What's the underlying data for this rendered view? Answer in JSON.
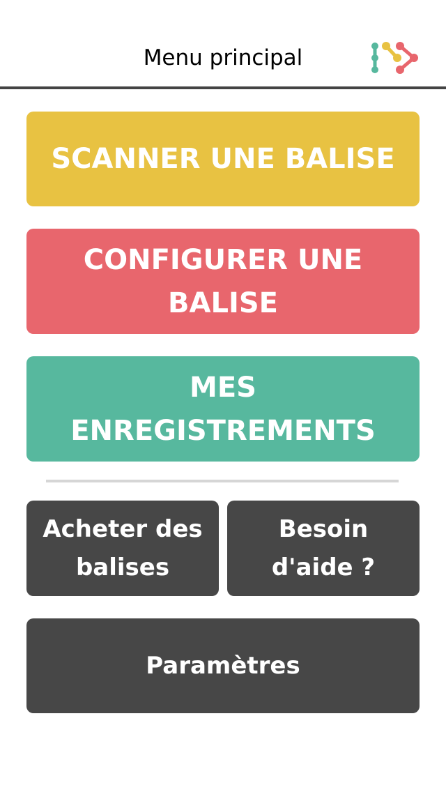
{
  "header": {
    "title": "Menu principal",
    "logo_icon": "network-nodes-logo"
  },
  "buttons": {
    "scan": {
      "label": "SCANNER UNE BALISE",
      "color": "#E8C242"
    },
    "configure": {
      "label": "CONFIGURER UNE BALISE",
      "color": "#E8666D"
    },
    "records": {
      "label": "MES ENREGISTREMENTS",
      "color": "#57B89E"
    },
    "buy": {
      "label": "Acheter des balises",
      "color": "#474747"
    },
    "help": {
      "label": "Besoin d'aide ?",
      "color": "#474747"
    },
    "settings": {
      "label": "Paramètres",
      "color": "#474747"
    }
  },
  "colors": {
    "header_border": "#444444",
    "divider": "#D6D6D6",
    "logo_teal": "#57B89E",
    "logo_yellow": "#E8C242",
    "logo_red": "#E8666D"
  }
}
